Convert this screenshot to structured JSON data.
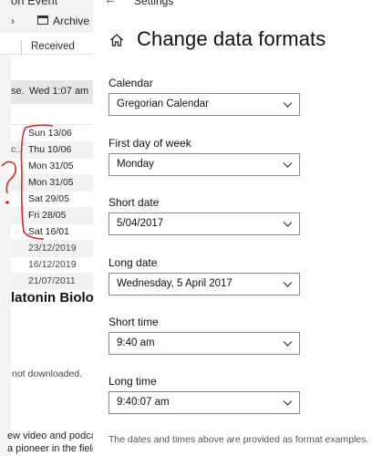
{
  "background_app": {
    "title_fragment": "on Event",
    "toolbar": {
      "chevron": "›",
      "archive_label": "Archive"
    },
    "column_header": {
      "received_label": "Received"
    },
    "selected_row": {
      "fragment": "se.",
      "date": "Wed 1:07 am"
    },
    "rows": [
      {
        "fragment": "",
        "date": "Sun 13/06"
      },
      {
        "fragment": "c..",
        "date": "Thu 10/06"
      },
      {
        "fragment": "",
        "date": "Mon 31/05"
      },
      {
        "fragment": "",
        "date": "Mon 31/05"
      },
      {
        "fragment": "",
        "date": "Sat 29/05"
      },
      {
        "fragment": "",
        "date": "Fri 28/05"
      },
      {
        "fragment": "",
        "date": "Sat 16/01"
      },
      {
        "fragment": "",
        "date": "23/12/2019"
      },
      {
        "fragment": "",
        "date": "16/12/2019"
      },
      {
        "fragment": "",
        "date": "21/07/2011"
      }
    ],
    "heading_fragment": "latonin Biology",
    "status_text": "not downloaded.",
    "preview_lines": [
      "ew video and podca",
      "a pioneer in the field"
    ],
    "annotation_color": "#d9262e"
  },
  "settings": {
    "app_name": "Settings",
    "back_icon": "back-arrow-icon",
    "title": "Change data formats",
    "fields": [
      {
        "label": "Calendar",
        "value": "Gregorian Calendar"
      },
      {
        "label": "First day of week",
        "value": "Monday"
      },
      {
        "label": "Short date",
        "value": "5/04/2017"
      },
      {
        "label": "Long date",
        "value": "Wednesday, 5 April 2017"
      },
      {
        "label": "Short time",
        "value": "9:40 am"
      },
      {
        "label": "Long time",
        "value": "9:40:07 am"
      }
    ],
    "footnote": "The dates and times above are provided as format examples."
  }
}
